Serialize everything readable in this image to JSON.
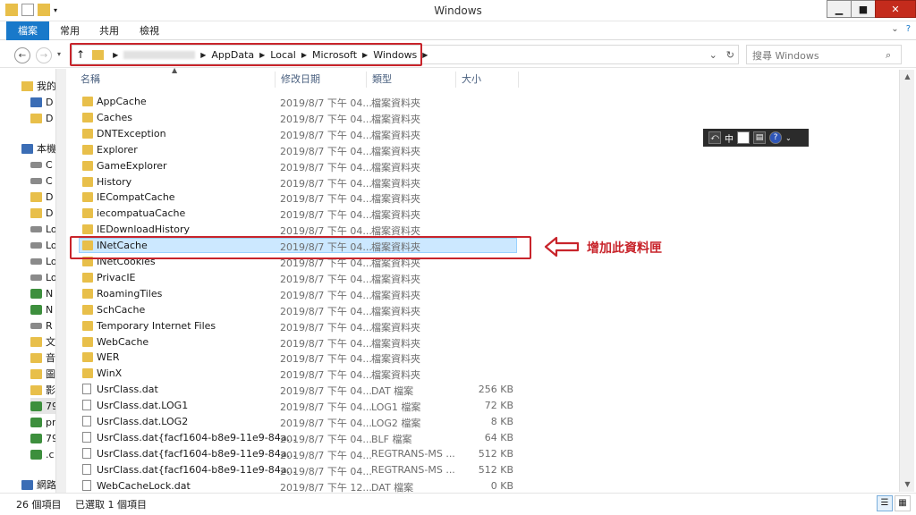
{
  "window": {
    "title": "Windows"
  },
  "ribbon": {
    "tabs": [
      "檔案",
      "常用",
      "共用",
      "檢視"
    ]
  },
  "address": {
    "crumbs": [
      "AppData",
      "Local",
      "Microsoft",
      "Windows"
    ],
    "search_placeholder": "搜尋 Windows"
  },
  "columns": {
    "name": "名稱",
    "date": "修改日期",
    "type": "類型",
    "size": "大小"
  },
  "navpane": {
    "items": [
      "我的",
      "D",
      "D",
      "本機",
      "C",
      "C",
      "D",
      "D",
      "Lo",
      "Lo",
      "Lo",
      "Lo",
      "N",
      "N",
      "R",
      "文",
      "音",
      "圖",
      "影",
      "79",
      "pr",
      "79",
      ".c",
      "網路"
    ]
  },
  "files": [
    {
      "name": "AppCache",
      "date": "2019/8/7 下午 04...",
      "type": "檔案資料夾",
      "size": "",
      "kind": "folder"
    },
    {
      "name": "Caches",
      "date": "2019/8/7 下午 04...",
      "type": "檔案資料夾",
      "size": "",
      "kind": "folder"
    },
    {
      "name": "DNTException",
      "date": "2019/8/7 下午 04...",
      "type": "檔案資料夾",
      "size": "",
      "kind": "folder"
    },
    {
      "name": "Explorer",
      "date": "2019/8/7 下午 04...",
      "type": "檔案資料夾",
      "size": "",
      "kind": "folder"
    },
    {
      "name": "GameExplorer",
      "date": "2019/8/7 下午 04...",
      "type": "檔案資料夾",
      "size": "",
      "kind": "folder"
    },
    {
      "name": "History",
      "date": "2019/8/7 下午 04...",
      "type": "檔案資料夾",
      "size": "",
      "kind": "folder"
    },
    {
      "name": "IECompatCache",
      "date": "2019/8/7 下午 04...",
      "type": "檔案資料夾",
      "size": "",
      "kind": "folder"
    },
    {
      "name": "iecompatuaCache",
      "date": "2019/8/7 下午 04...",
      "type": "檔案資料夾",
      "size": "",
      "kind": "folder"
    },
    {
      "name": "IEDownloadHistory",
      "date": "2019/8/7 下午 04...",
      "type": "檔案資料夾",
      "size": "",
      "kind": "folder"
    },
    {
      "name": "INetCache",
      "date": "2019/8/7 下午 04...",
      "type": "檔案資料夾",
      "size": "",
      "kind": "folder",
      "selected": true
    },
    {
      "name": "INetCookies",
      "date": "2019/8/7 下午 04...",
      "type": "檔案資料夾",
      "size": "",
      "kind": "folder"
    },
    {
      "name": "PrivacIE",
      "date": "2019/8/7 下午 04...",
      "type": "檔案資料夾",
      "size": "",
      "kind": "folder"
    },
    {
      "name": "RoamingTiles",
      "date": "2019/8/7 下午 04...",
      "type": "檔案資料夾",
      "size": "",
      "kind": "folder"
    },
    {
      "name": "SchCache",
      "date": "2019/8/7 下午 04...",
      "type": "檔案資料夾",
      "size": "",
      "kind": "folder"
    },
    {
      "name": "Temporary Internet Files",
      "date": "2019/8/7 下午 04...",
      "type": "檔案資料夾",
      "size": "",
      "kind": "folder"
    },
    {
      "name": "WebCache",
      "date": "2019/8/7 下午 04...",
      "type": "檔案資料夾",
      "size": "",
      "kind": "folder"
    },
    {
      "name": "WER",
      "date": "2019/8/7 下午 04...",
      "type": "檔案資料夾",
      "size": "",
      "kind": "folder"
    },
    {
      "name": "WinX",
      "date": "2019/8/7 下午 04...",
      "type": "檔案資料夾",
      "size": "",
      "kind": "folder"
    },
    {
      "name": "UsrClass.dat",
      "date": "2019/8/7 下午 04...",
      "type": "DAT 檔案",
      "size": "256 KB",
      "kind": "file"
    },
    {
      "name": "UsrClass.dat.LOG1",
      "date": "2019/8/7 下午 04...",
      "type": "LOG1 檔案",
      "size": "72 KB",
      "kind": "file"
    },
    {
      "name": "UsrClass.dat.LOG2",
      "date": "2019/8/7 下午 04...",
      "type": "LOG2 檔案",
      "size": "8 KB",
      "kind": "file"
    },
    {
      "name": "UsrClass.dat{facf1604-b8e9-11e9-84a...",
      "date": "2019/8/7 下午 04...",
      "type": "BLF 檔案",
      "size": "64 KB",
      "kind": "file"
    },
    {
      "name": "UsrClass.dat{facf1604-b8e9-11e9-84a...",
      "date": "2019/8/7 下午 04...",
      "type": "REGTRANS-MS ...",
      "size": "512 KB",
      "kind": "file"
    },
    {
      "name": "UsrClass.dat{facf1604-b8e9-11e9-84a...",
      "date": "2019/8/7 下午 04...",
      "type": "REGTRANS-MS ...",
      "size": "512 KB",
      "kind": "file"
    },
    {
      "name": "WebCacheLock.dat",
      "date": "2019/8/7 下午 12...",
      "type": "DAT 檔案",
      "size": "0 KB",
      "kind": "file"
    }
  ],
  "annotation": {
    "text": "增加此資料匣",
    "color": "#c8242b"
  },
  "ime": {
    "mode": "中"
  },
  "status": {
    "count": "26 個項目",
    "selected": "已選取 1 個項目"
  },
  "colors": {
    "accent": "#1979ca",
    "selection": "#cce8ff",
    "highlight": "#c8242b"
  }
}
